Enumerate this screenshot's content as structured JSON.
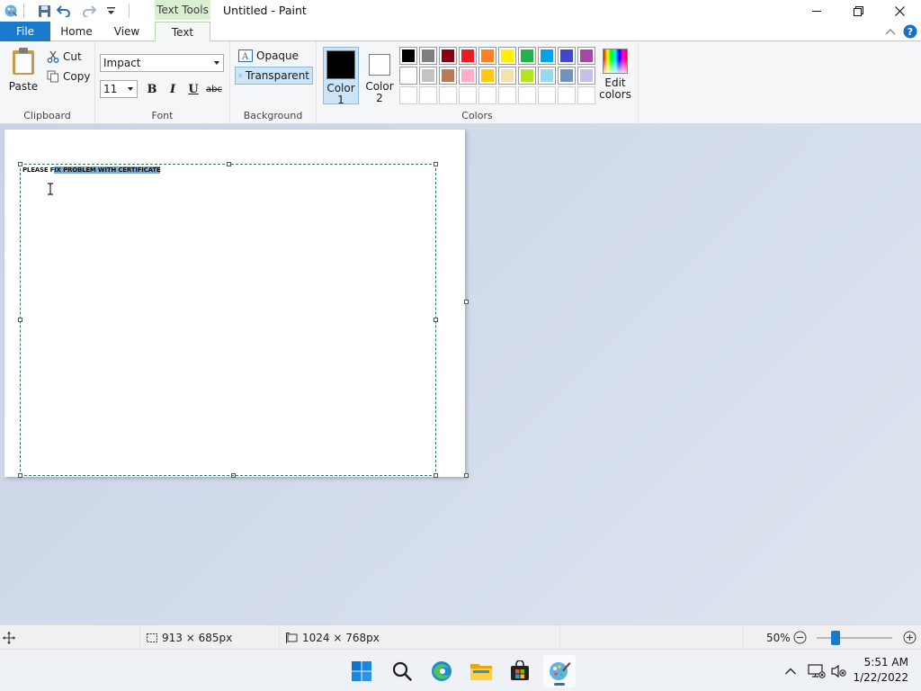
{
  "window": {
    "title": "Untitled - Paint",
    "context_tab": "Text Tools"
  },
  "tabs": {
    "file": "File",
    "home": "Home",
    "view": "View",
    "text": "Text"
  },
  "clipboard": {
    "paste": "Paste",
    "cut": "Cut",
    "copy": "Copy",
    "label": "Clipboard"
  },
  "font": {
    "family": "Impact",
    "size": "11",
    "bold": "B",
    "italic": "I",
    "underline": "U",
    "strike": "abc",
    "label": "Font"
  },
  "background": {
    "opaque": "Opaque",
    "transparent": "Transparent",
    "label": "Background"
  },
  "colors": {
    "color1_line1": "Color",
    "color1_line2": "1",
    "color2_line1": "Color",
    "color2_line2": "2",
    "edit_line1": "Edit",
    "edit_line2": "colors",
    "label": "Colors",
    "color1_value": "#000000",
    "color2_value": "#ffffff",
    "palette": [
      "#000000",
      "#7f7f7f",
      "#880015",
      "#ed1c24",
      "#ff7f27",
      "#fff200",
      "#22b14c",
      "#00a2e8",
      "#3f48cc",
      "#a349a4",
      "#ffffff",
      "#c3c3c3",
      "#b97a57",
      "#ffaec9",
      "#ffc90e",
      "#efe4b0",
      "#b5e61d",
      "#99d9ea",
      "#7092be",
      "#c8bfe7",
      "",
      "",
      "",
      "",
      "",
      "",
      "",
      "",
      "",
      ""
    ]
  },
  "canvas": {
    "typed_plain": "PLEASE F",
    "typed_selected": "IX PROBLEM WITH CERTIFICATE"
  },
  "status": {
    "selection_size": "913 × 685px",
    "image_size": "1024 × 768px",
    "zoom": "50%"
  },
  "taskbar": {
    "time": "5:51 AM",
    "date": "1/22/2022"
  }
}
